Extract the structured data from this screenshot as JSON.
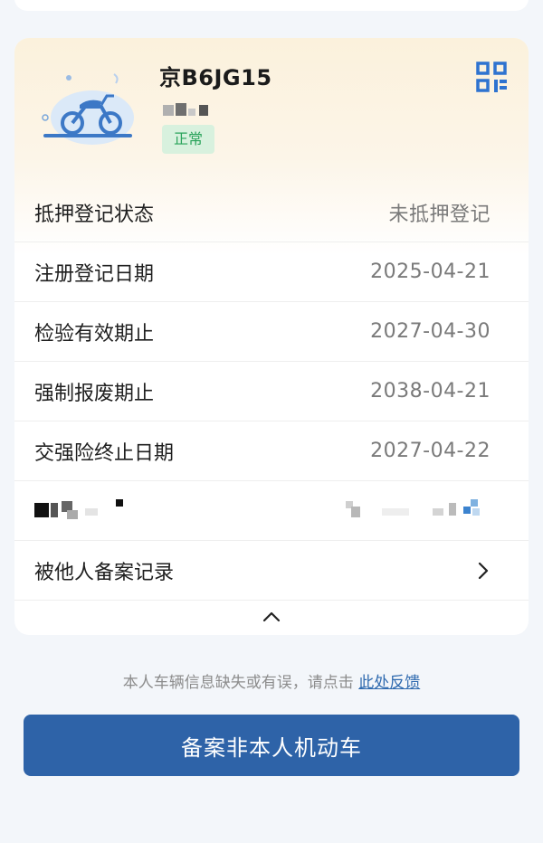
{
  "vehicle": {
    "plate": "京B6JG15",
    "status": "正常",
    "illustration_icon": "motorcycle-icon",
    "qr_icon": "qr-code-icon"
  },
  "details": [
    {
      "label": "抵押登记状态",
      "value": "未抵押登记"
    },
    {
      "label": "注册登记日期",
      "value": "2025-04-21"
    },
    {
      "label": "检验有效期止",
      "value": "2027-04-30"
    },
    {
      "label": "强制报废期止",
      "value": "2038-04-21"
    },
    {
      "label": "交强险终止日期",
      "value": "2027-04-22"
    }
  ],
  "filing_record": {
    "label": "被他人备案记录",
    "icon": "chevron-right-icon"
  },
  "collapse": {
    "icon": "chevron-up-icon"
  },
  "feedback": {
    "text": "本人车辆信息缺失或有误，请点击",
    "link": "此处反馈"
  },
  "primary_button": {
    "label": "备案非本人机动车"
  },
  "colors": {
    "accent": "#2e63a8",
    "status_bg": "#d8f1de",
    "status_text": "#29a35a",
    "link": "#2f6aaf",
    "header_gradient_top": "#fbf1dc"
  }
}
